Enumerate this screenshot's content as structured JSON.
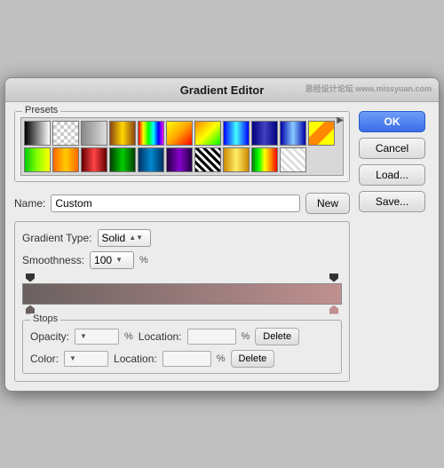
{
  "dialog": {
    "title": "Gradient Editor",
    "watermark": "思经设计论坛 www.missyuan.com"
  },
  "presets": {
    "label": "Presets",
    "expand_arrow": "▶"
  },
  "buttons": {
    "ok": "OK",
    "cancel": "Cancel",
    "load": "Load...",
    "save": "Save...",
    "new": "New",
    "delete": "Delete"
  },
  "name_row": {
    "label": "Name:",
    "value": "Custom"
  },
  "gradient_type": {
    "label": "Gradient Type:",
    "value": "Solid"
  },
  "smoothness": {
    "label": "Smoothness:",
    "value": "100",
    "unit": "%"
  },
  "stops": {
    "label": "Stops",
    "opacity_label": "Opacity:",
    "opacity_value": "",
    "opacity_pct": "%",
    "location_label": "Location:",
    "location_value": "",
    "location_pct": "%",
    "color_label": "Color:",
    "color_value": "",
    "color_location_label": "Location:",
    "color_location_value": "",
    "color_location_pct": "%"
  }
}
